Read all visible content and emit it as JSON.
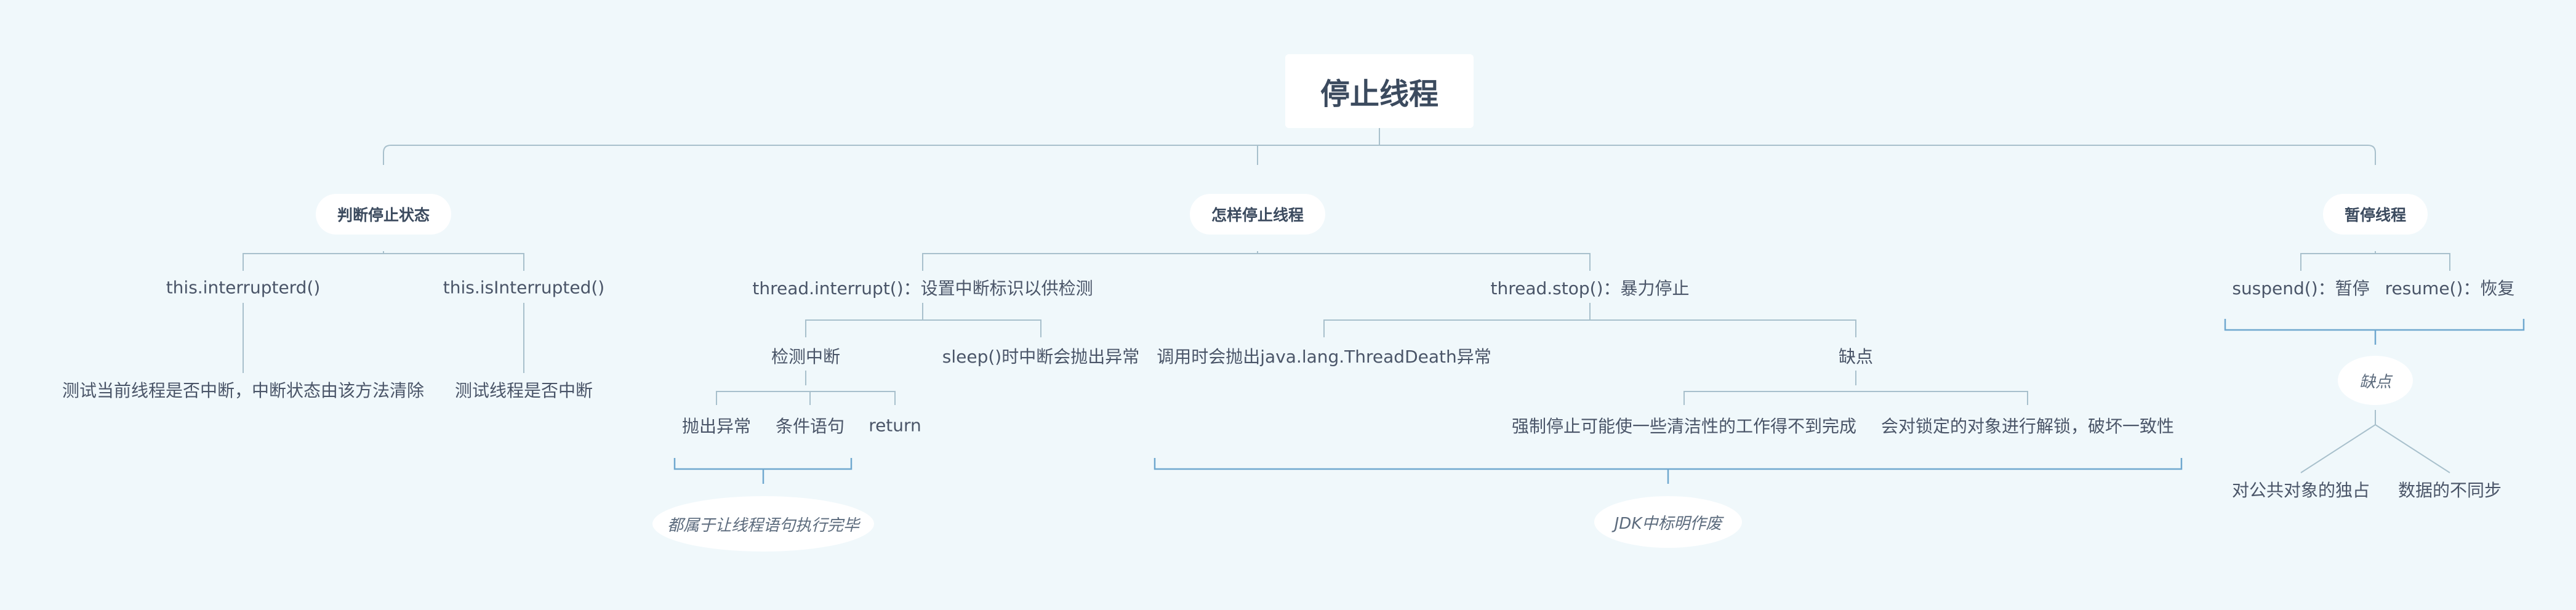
{
  "root": "停止线程",
  "branches": {
    "judge": {
      "label": "判断停止状态",
      "items": [
        "this.interrupterd()",
        "this.isInterrupted()"
      ],
      "descs": [
        "测试当前线程是否中断，中断状态由该方法清除",
        "测试线程是否中断"
      ]
    },
    "how": {
      "label": "怎样停止线程",
      "interrupt": {
        "label": "thread.interrupt()：设置中断标识以供检测",
        "detect": "检测中断",
        "detect_children": [
          "抛出异常",
          "条件语句",
          "return"
        ],
        "summary": "都属于让线程语句执行完毕",
        "sleep": "sleep()时中断会抛出异常"
      },
      "stop": {
        "label": "thread.stop()：暴力停止",
        "call": "调用时会抛出java.lang.ThreadDeath异常",
        "cons": "缺点",
        "cons_children": [
          "强制停止可能使一些清洁性的工作得不到完成",
          "会对锁定的对象进行解锁，破坏一致性"
        ],
        "summary": "JDK中标明作废"
      }
    },
    "pause": {
      "label": "暂停线程",
      "items": [
        "suspend()：暂停",
        "resume()：恢复"
      ],
      "summary": "缺点",
      "cons": [
        "对公共对象的独占",
        "数据的不同步"
      ]
    }
  },
  "colors": {
    "background": "#f0f8fb",
    "line": "#a8c0cc",
    "bracket": "#6fa8cf",
    "text": "#3b4a5e"
  }
}
